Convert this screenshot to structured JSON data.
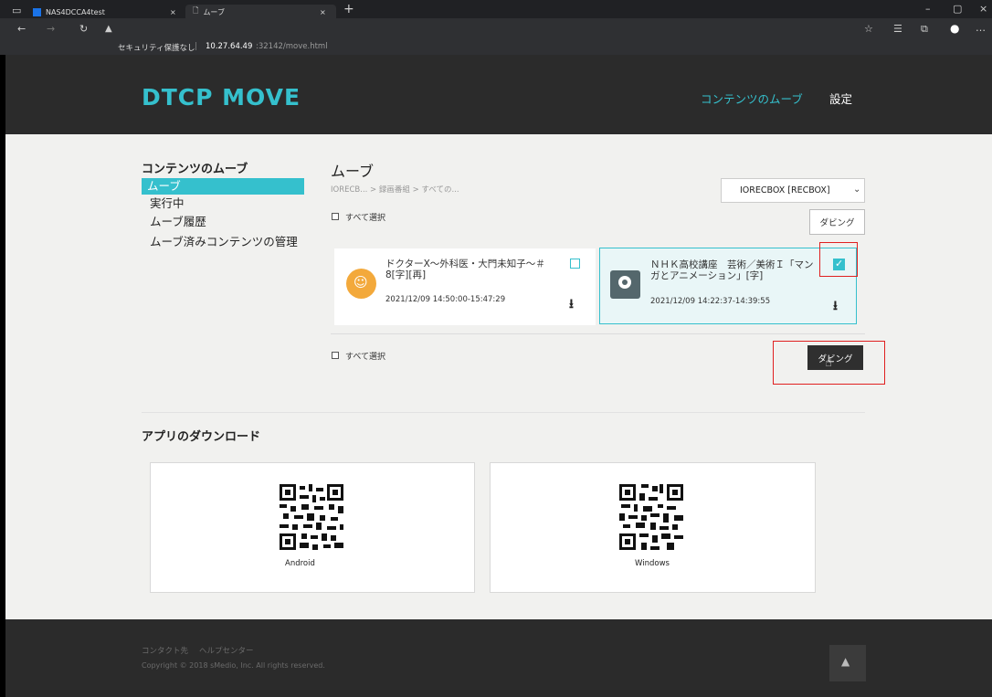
{
  "browser": {
    "tabs": [
      {
        "title": "NAS4DCCA4test"
      },
      {
        "title": "ムーブ"
      }
    ],
    "security_label": "セキュリティ保護なし",
    "url_host": "10.27.64.49",
    "url_rest": ":32142/move.html"
  },
  "header": {
    "logo": "DTCP MOVE",
    "nav_move": "コンテンツのムーブ",
    "nav_settings": "設定"
  },
  "sidebar": {
    "title": "コンテンツのムーブ",
    "items": [
      {
        "label": "ムーブ"
      },
      {
        "label": "実行中"
      },
      {
        "label": "ムーブ履歴"
      },
      {
        "label": "ムーブ済みコンテンツの管理"
      }
    ]
  },
  "main": {
    "title": "ムーブ",
    "breadcrumb": "IORECB... > 録画番組 > すべての...",
    "device_select": "IORECBOX [RECBOX]",
    "select_all_label": "すべて選択",
    "dubbing_label": "ダビング",
    "contents": [
      {
        "title": "ドクターX～外科医・大門未知子～＃8[字][再]",
        "datetime": "2021/12/09 14:50:00-15:47:29",
        "checked": false
      },
      {
        "title": "ＮＨＫ高校講座　芸術／美術Ｉ「マンガとアニメーション」[字]",
        "datetime": "2021/12/09 14:22:37-14:39:55",
        "checked": true
      }
    ]
  },
  "apps": {
    "title": "アプリのダウンロード",
    "items": [
      {
        "label": "Android"
      },
      {
        "label": "Windows"
      }
    ]
  },
  "footer": {
    "contact": "コンタクト先",
    "help": "ヘルプセンター",
    "copyright": "Copyright © 2018 sMedio, Inc. All rights reserved."
  },
  "colors": {
    "accent": "#35c0cd",
    "header_bg": "#2b2b2b",
    "page_bg": "#f1f1ef",
    "highlight": "#e02020"
  }
}
